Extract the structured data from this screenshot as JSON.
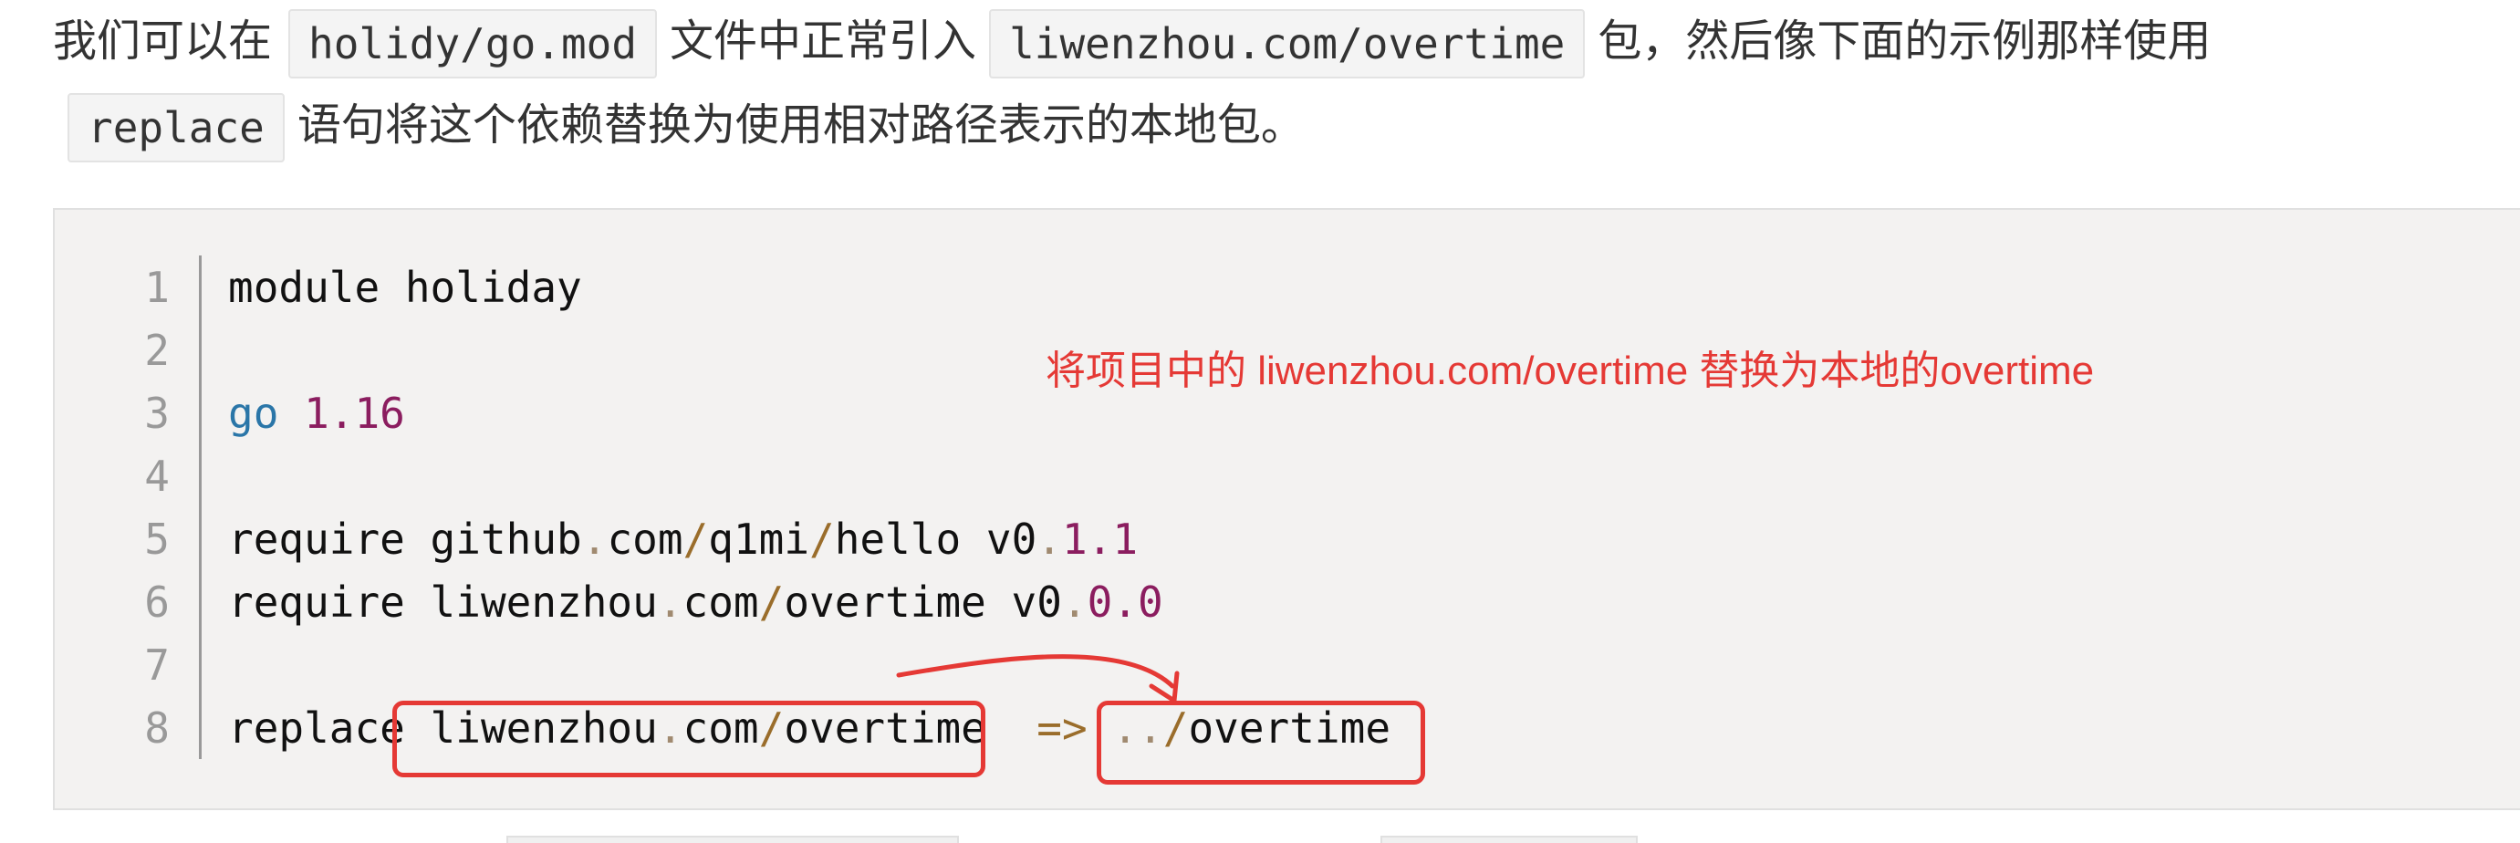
{
  "paragraph": {
    "line1": {
      "text_before": "我们可以在",
      "code1": "holidy/go.mod",
      "text_middle": "文件中正常引入",
      "code2": "liwenzhou.com/overtime",
      "text_after": "包，然后像下面的示例那样使用"
    },
    "line2": {
      "code": "replace",
      "text_after": "语句将这个依赖替换为使用相对路径表示的本地包。"
    }
  },
  "code_block": {
    "line_numbers": [
      "1",
      "2",
      "3",
      "4",
      "5",
      "6",
      "7",
      "8"
    ],
    "lines": {
      "l1": "module holiday",
      "l3_kw": "go",
      "l3_num": "1.16",
      "l5": {
        "a": "require github",
        "dot1": ".",
        "b": "com",
        "slash1": "/",
        "c": "q1mi",
        "slash2": "/",
        "d": "hello v0",
        "dot2": ".",
        "num": "1.1"
      },
      "l6": {
        "a": "require liwenzhou",
        "dot1": ".",
        "b": "com",
        "slash1": "/",
        "c": "overtime v0",
        "dot2": ".",
        "num": "0.0"
      },
      "l8": {
        "a": "replace liwenzhou",
        "dot1": ".",
        "b": "com",
        "slash1": "/",
        "c": "overtime",
        "arrow": "=>",
        "dots": "..",
        "slash2": "/",
        "d": "overtime"
      }
    }
  },
  "annotation": {
    "text": "将项目中的 liwenzhou.com/overtime 替换为本地的overtime",
    "color": "#e53935"
  }
}
